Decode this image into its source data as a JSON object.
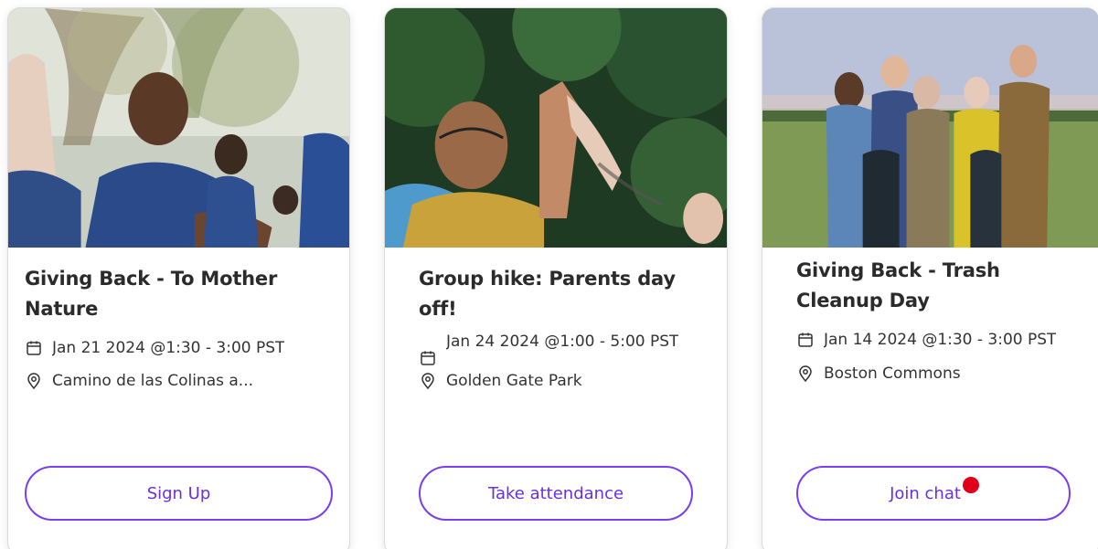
{
  "cards": [
    {
      "title": "Giving Back - To Mother Nature",
      "date": "Jan 21 2024 @1:30 - 3:00 PST",
      "location": "Camino de las Colinas a...",
      "button_label": "Sign Up",
      "date_icon": "calendar-icon",
      "location_icon": "location-pin-icon"
    },
    {
      "title": "Group hike: Parents day off!",
      "date": "Jan 24 2024 @1:00 - 5:00 PST",
      "location": "Golden Gate Park",
      "button_label": "Take attendance",
      "date_icon": "calendar-icon",
      "location_icon": "location-pin-icon"
    },
    {
      "title": "Giving Back - Trash Cleanup Day",
      "date": "Jan 14 2024 @1:30 - 3:00 PST",
      "location": "Boston Commons",
      "button_label": "Join chat",
      "has_notification": true,
      "date_icon": "calendar-icon",
      "location_icon": "location-pin-icon"
    }
  ],
  "colors": {
    "accent": "#7a3df0",
    "accent_text": "#6a2fe0",
    "notification": "#e0001a",
    "title_text": "#2b2b2b",
    "card_border": "#d9d9de"
  }
}
